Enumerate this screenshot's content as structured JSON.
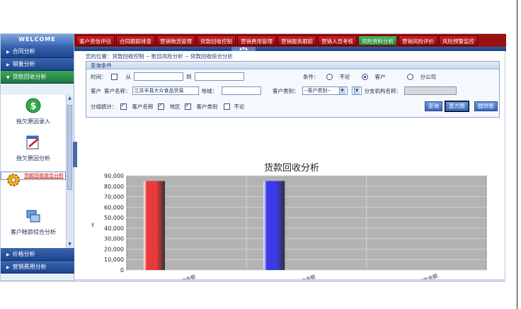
{
  "sidebar": {
    "welcome": "WELCOME",
    "items_top": [
      {
        "label": "合同分析"
      },
      {
        "label": "销量分析"
      },
      {
        "label": "贷款回收分析"
      }
    ],
    "tools": [
      {
        "label": "拖欠原因录入",
        "icon": "dollar-coin-icon"
      },
      {
        "label": "拖欠原因分析",
        "icon": "edit-document-icon"
      },
      {
        "label": "贷款回收综合分析",
        "icon": "gear-icon"
      },
      {
        "label": "客户帐龄综合分析",
        "icon": "windows-icon"
      }
    ],
    "items_bottom": [
      {
        "label": "价格分析"
      },
      {
        "label": "营销费用分析"
      }
    ]
  },
  "topnav": {
    "tabs": [
      "客户资信评估",
      "合同跟踪排查",
      "营销物流管理",
      "贷款回收控制",
      "营销费用管理",
      "营销服务跟踪",
      "营销人员考核",
      "风险资料分析",
      "营销风险评价",
      "风险预警监控"
    ],
    "active_index": 7
  },
  "breadcrumb": "您的位置：贷款回收控制 -- 账目风险分析 -- 贷款回收综合分析",
  "query": {
    "title": "查询条件",
    "time_label": "时间：",
    "from_label": "从",
    "to_label": "到",
    "from_value": "",
    "to_value": "",
    "condition_label": "条件：",
    "cond_options": [
      "不论",
      "客户",
      "分公司"
    ],
    "cond_selected": 1,
    "customer_label": "客户",
    "customer_name_label": "客户名称：",
    "customer_name_value": "江苏丰县大众食品贸易",
    "region_label": "地域：",
    "region_value": "",
    "category_label": "客户类别：",
    "category_value": "--客户类别--",
    "branch_label": "分支机构名称：",
    "branch_value": "",
    "group_label": "分组统计：",
    "group_options": [
      "客户名称",
      "地区",
      "客户类别",
      "不论"
    ],
    "group_checked": [
      true,
      true,
      true,
      false
    ],
    "buttons": [
      "查询",
      "直方图",
      "圆饼图"
    ]
  },
  "chart_data": {
    "type": "bar",
    "title": "货款回收分析",
    "ylabel": "y",
    "categories": [
      "应收金额",
      "已收金额",
      "未付款金额"
    ],
    "series": [
      {
        "values": [
          85000,
          85000,
          0
        ]
      }
    ],
    "bar_colors": [
      "#e83a3a",
      "#3a3ae8",
      "#888888"
    ],
    "yticks": [
      0,
      10000,
      20000,
      30000,
      40000,
      50000,
      60000,
      70000,
      80000,
      90000
    ],
    "ytick_labels": [
      "0",
      "10,000",
      "20,000",
      "30,000",
      "40,000",
      "50,000",
      "60,000",
      "70,000",
      "80,000",
      "90,000"
    ],
    "ylim": [
      0,
      90000
    ],
    "grid": true,
    "plot_bg": "#b3b3b3"
  }
}
